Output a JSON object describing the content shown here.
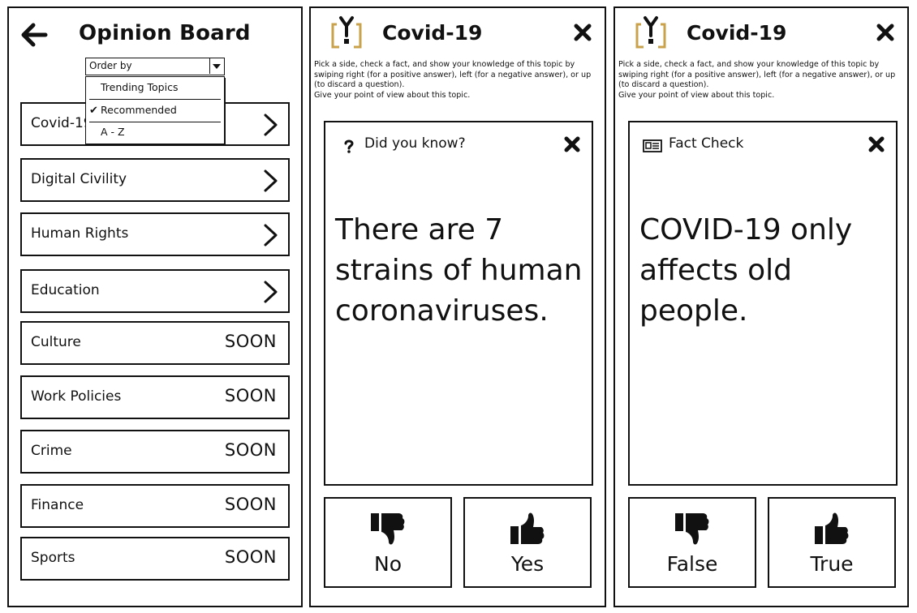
{
  "board": {
    "title": "Opinion Board",
    "order_by": {
      "label": "Order by",
      "options": [
        "Trending Topics",
        "Recommended",
        "A - Z"
      ],
      "selected": "Recommended"
    },
    "topics": [
      {
        "label": "Covid-19",
        "action": "chevron"
      },
      {
        "label": "Digital Civility",
        "action": "chevron"
      },
      {
        "label": "Human Rights",
        "action": "chevron"
      },
      {
        "label": "Education",
        "action": "chevron"
      },
      {
        "label": "Culture",
        "action": "SOON"
      },
      {
        "label": "Work Policies",
        "action": "SOON"
      },
      {
        "label": "Crime",
        "action": "SOON"
      },
      {
        "label": "Finance",
        "action": "SOON"
      },
      {
        "label": "Sports",
        "action": "SOON"
      }
    ]
  },
  "shared": {
    "topic_title": "Covid-19",
    "instructions": "Pick a side, check a fact, and show your knowledge of this topic by swiping right (for a positive answer), left (for a negative answer), or up (to discard a question).\nGive your point of view about this topic.",
    "icons": [
      "back-arrow-icon",
      "chevron-right-icon",
      "logo-icon",
      "close-icon",
      "question-icon",
      "newspaper-icon",
      "thumbs-down-icon",
      "thumbs-up-icon"
    ]
  },
  "did_you_know": {
    "header": "Did you know?",
    "statement": "There are 7 strains of human coronaviruses.",
    "no_label": "No",
    "yes_label": "Yes"
  },
  "fact_check": {
    "header": "Fact Check",
    "statement": "COVID-19 only affects old people.",
    "false_label": "False",
    "true_label": "True"
  }
}
